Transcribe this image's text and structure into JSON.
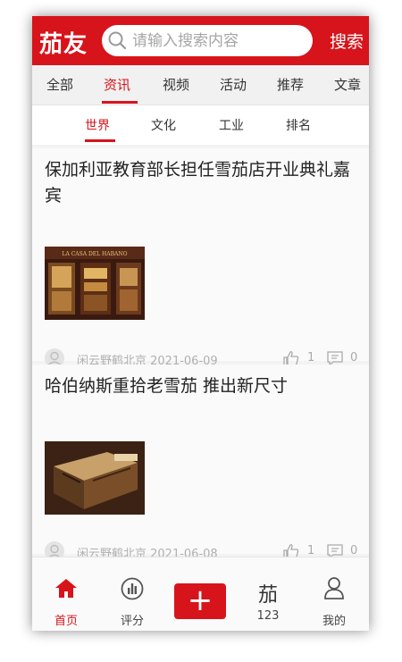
{
  "header": {
    "logo": "茄友",
    "search_placeholder": "请输入搜索内容",
    "search_button": "搜索"
  },
  "tabs": [
    "全部",
    "资讯",
    "视频",
    "活动",
    "推荐",
    "文章"
  ],
  "active_tab": "资讯",
  "subtabs": [
    "世界",
    "文化",
    "工业",
    "排名"
  ],
  "active_subtab": "世界",
  "articles": [
    {
      "title": "保加利亚教育部长担任雪茄店开业典礼嘉宾",
      "image_text": "LA CASA DEL HABANO",
      "author_date": "闲云野鹤北京 2021-06-09",
      "likes": "1",
      "comments": "0"
    },
    {
      "title": "哈伯纳斯重拾老雪茄 推出新尺寸",
      "author_date": "闲云野鹤北京 2021-06-08",
      "likes": "1",
      "comments": "0"
    }
  ],
  "bottom_nav": {
    "home": "首页",
    "rating": "评分",
    "add": "+",
    "cigar_char": "茄",
    "cigar_label": "123",
    "mine": "我的"
  },
  "colors": {
    "brand_red": "#d7141b"
  }
}
